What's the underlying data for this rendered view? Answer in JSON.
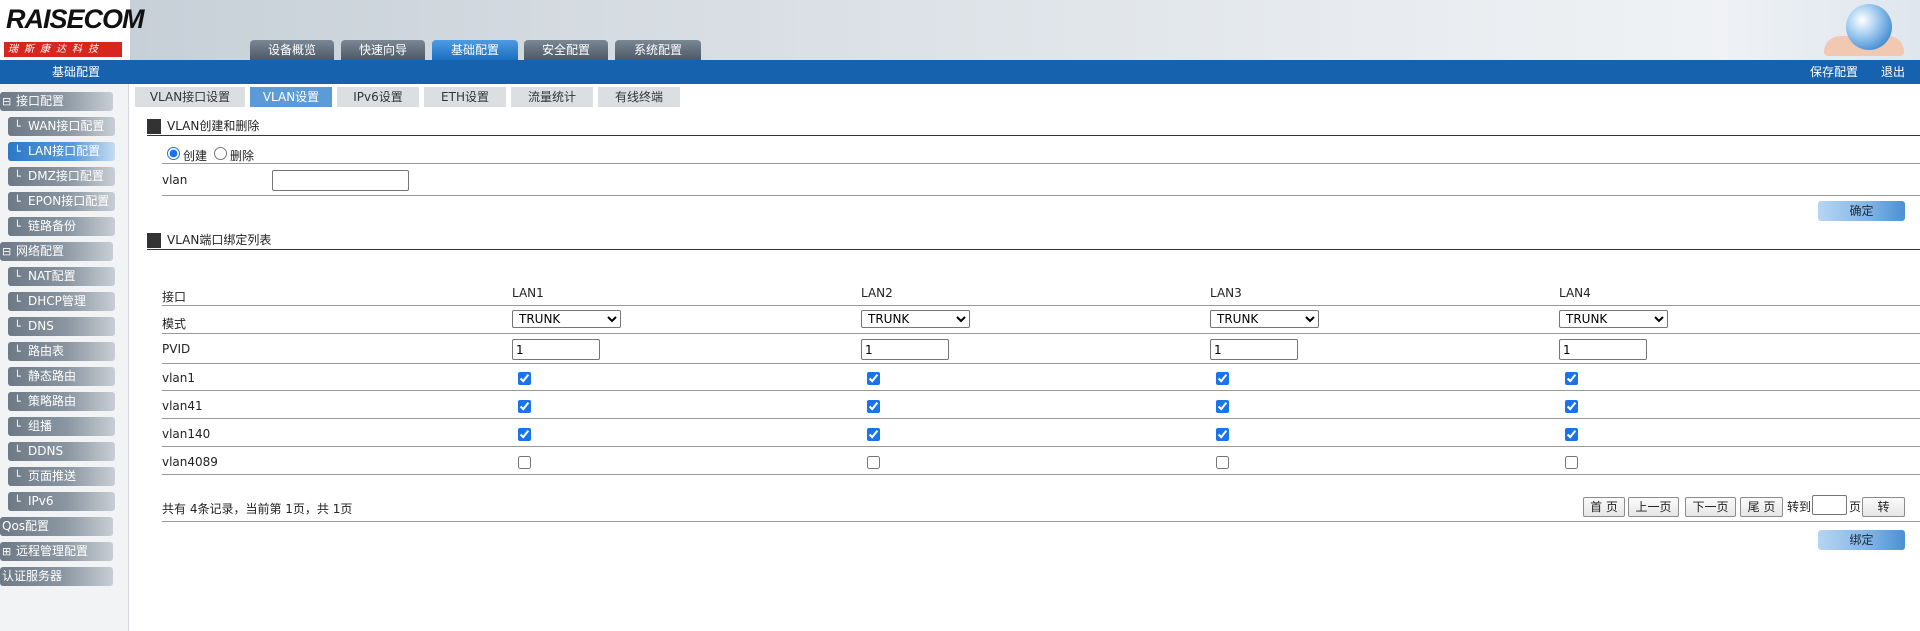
{
  "header": {
    "logo_text": "RAISECOM",
    "logo_sub": "瑞斯康达科技",
    "tabs": [
      "设备概览",
      "快速向导",
      "基础配置",
      "安全配置",
      "系统配置"
    ],
    "active_tab": "基础配置",
    "breadcrumb": "基础配置",
    "save_label": "保存配置",
    "logout_label": "退出"
  },
  "sidebar": {
    "groups": [
      {
        "label": "接口配置",
        "prefix": "⊟"
      },
      {
        "label": "网络配置",
        "prefix": "⊟"
      },
      {
        "label": "Qos配置",
        "prefix": ""
      },
      {
        "label": "远程管理配置",
        "prefix": "⊞"
      },
      {
        "label": "认证服务器",
        "prefix": ""
      }
    ],
    "items": [
      "WAN接口配置",
      "LAN接口配置",
      "DMZ接口配置",
      "EPON接口配置",
      "链路备份",
      "NAT配置",
      "DHCP管理",
      "DNS",
      "路由表",
      "静态路由",
      "策略路由",
      "组播",
      "DDNS",
      "页面推送",
      "IPv6"
    ],
    "active_item": "LAN接口配置"
  },
  "subtabs": [
    "VLAN接口设置",
    "VLAN设置",
    "IPv6设置",
    "ETH设置",
    "流量统计",
    "有线终端"
  ],
  "active_subtab": "VLAN设置",
  "create_section": {
    "title": "VLAN创建和删除",
    "radio_create": "创建",
    "radio_delete": "删除",
    "vlan_label": "vlan",
    "vlan_value": "",
    "confirm_label": "确定"
  },
  "bind_section": {
    "title": "VLAN端口绑定列表",
    "port_label": "接口",
    "mode_label": "模式",
    "pvid_label": "PVID",
    "ports": [
      {
        "name": "LAN1",
        "mode": "TRUNK",
        "pvid": "1"
      },
      {
        "name": "LAN2",
        "mode": "TRUNK",
        "pvid": "1"
      },
      {
        "name": "LAN3",
        "mode": "TRUNK",
        "pvid": "1"
      },
      {
        "name": "LAN4",
        "mode": "TRUNK",
        "pvid": "1"
      }
    ],
    "vlans": [
      {
        "name": "vlan1",
        "checked": [
          true,
          true,
          true,
          true
        ]
      },
      {
        "name": "vlan41",
        "checked": [
          true,
          true,
          true,
          true
        ]
      },
      {
        "name": "vlan140",
        "checked": [
          true,
          true,
          true,
          true
        ]
      },
      {
        "name": "vlan4089",
        "checked": [
          false,
          false,
          false,
          false
        ]
      }
    ],
    "summary": "共有 4条记录，当前第 1页，共 1页",
    "pager": {
      "first": "首 页",
      "prev": "上一页",
      "next": "下一页",
      "last": "尾 页",
      "goto_label": "转到",
      "page_unit": "页",
      "go": "转",
      "goto_value": ""
    },
    "bind_label": "绑定"
  },
  "colors": {
    "header_bar": "#1762ae",
    "active_tab": "#2f84d6",
    "sidebar_item": "#7d8994"
  }
}
